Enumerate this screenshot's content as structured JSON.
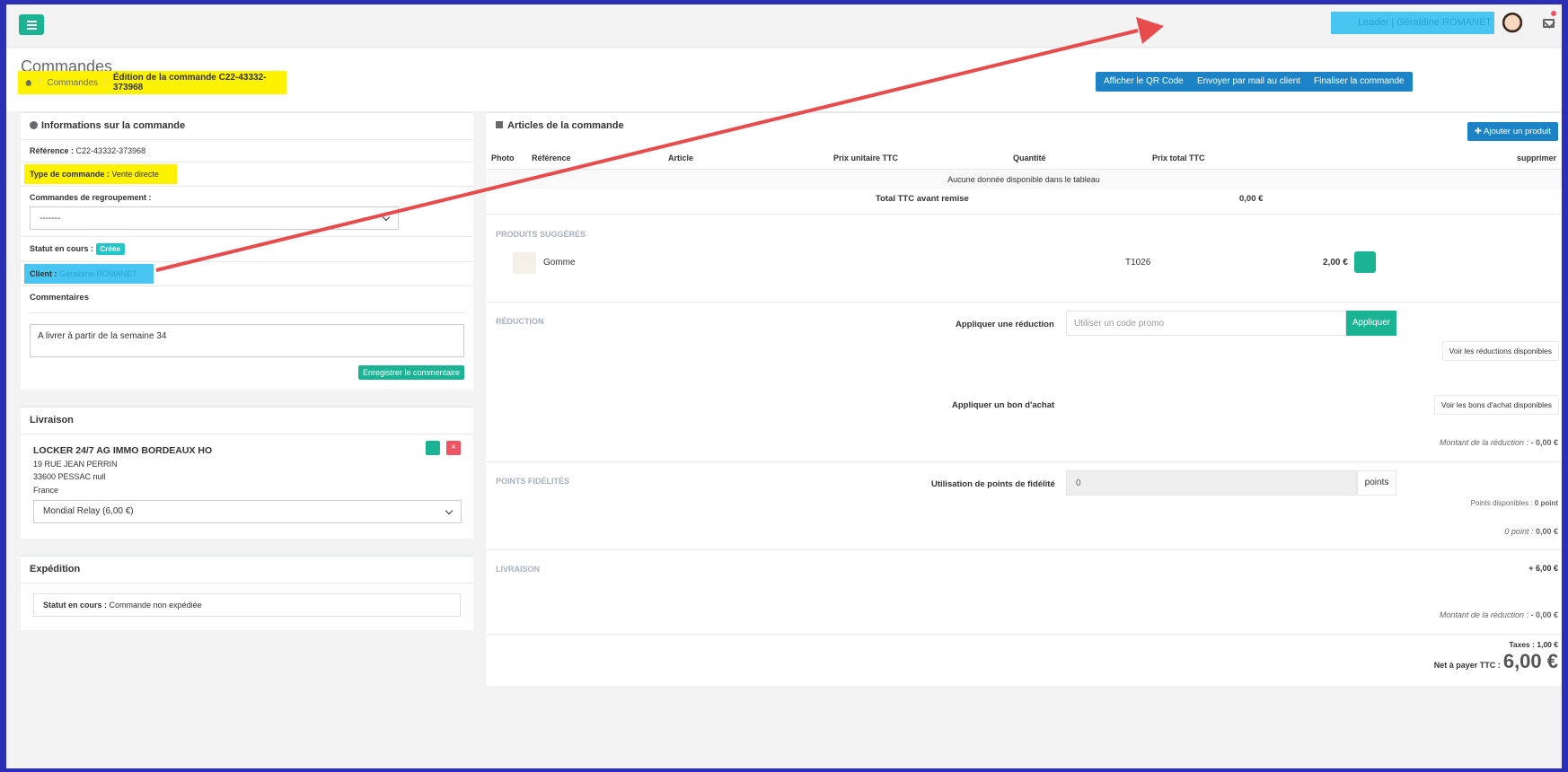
{
  "topbar": {
    "user_role": "Leader",
    "user_name": "Géraldine ROMANET"
  },
  "header": {
    "title": "Commandes",
    "breadcrumb": [
      "Commandes",
      "Édition de la commande C22-43332-373968"
    ],
    "buttons": [
      "Afficher le QR Code",
      "Envoyer par mail au client",
      "Finaliser la commande"
    ]
  },
  "info": {
    "title": "Informations sur la commande",
    "reference_label": "Référence :",
    "reference": "C22-43332-373968",
    "type_label": "Type de commande :",
    "type": "Vente directe",
    "regroup_label": "Commandes de regroupement :",
    "regroup_value": "-------",
    "status_label": "Statut en cours :",
    "status": "Créée",
    "client_label": "Client :",
    "client": "Géraldine ROMANET",
    "comments_label": "Commentaires",
    "comment": "A livrer à partir de la semaine 34",
    "save_comment": "Enregistrer le commentaire"
  },
  "delivery": {
    "title": "Livraison",
    "name": "LOCKER 24/7 AG IMMO BORDEAUX HO",
    "address1": "19 RUE JEAN PERRIN",
    "address2": "33600 PESSAC null",
    "country": "France",
    "method": "Mondial Relay (6,00 €)"
  },
  "shipping": {
    "title": "Expédition",
    "status_label": "Statut en cours :",
    "status": "Commande non expédiée"
  },
  "articles": {
    "title": "Articles de la commande",
    "add_button": "Ajouter un produit",
    "columns": [
      "Photo",
      "Référence",
      "Article",
      "Prix unitaire TTC",
      "Quantité",
      "Prix total TTC",
      "supprimer"
    ],
    "empty": "Aucune donnée disponible dans le tableau",
    "total_label": "Total TTC avant remise",
    "total_value": "0,00 €"
  },
  "suggested": {
    "label": "PRODUITS SUGGÉRÉS",
    "product": "Gomme",
    "ref": "T1026",
    "price": "2,00 €"
  },
  "reduction": {
    "label": "RÉDUCTION",
    "apply_label": "Appliquer une réduction",
    "promo_placeholder": "Utiliser un code promo",
    "apply_button": "Appliquer",
    "see_reductions": "Voir les réductions disponibles",
    "voucher_label": "Appliquer un bon d'achat",
    "see_vouchers": "Voir les bons d'achat disponibles",
    "amount_label": "Montant de la réduction :",
    "amount": "- 0,00 €"
  },
  "loyalty": {
    "label": "POINTS FIDÉLITÉS",
    "use_label": "Utilisation de points de fidélité",
    "value": "0",
    "unit": "points",
    "available_label": "Points disponibles :",
    "available": "0 point",
    "summary_label": "0 point :",
    "summary": "0,00 €"
  },
  "shipping_cost": {
    "label": "LIVRAISON",
    "value": "+ 6,00 €",
    "reduction_label": "Montant de la réduction :",
    "reduction": "- 0,00 €"
  },
  "totals": {
    "tax_label": "Taxes :",
    "tax": "1,00 €",
    "net_label": "Net à payer TTC :",
    "net": "6,00 €"
  }
}
